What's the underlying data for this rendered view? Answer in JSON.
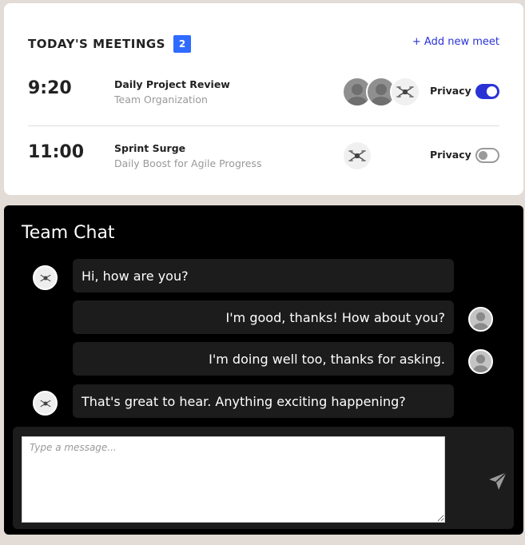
{
  "meetings": {
    "title": "TODAY'S MEETINGS",
    "count": "2",
    "add_label": "+ Add new meet",
    "items": [
      {
        "time": "9:20",
        "title": "Daily Project Review",
        "subtitle": "Team Organization",
        "privacy_label": "Privacy",
        "privacy_on": true,
        "avatars": [
          "person-avatar",
          "person-avatar",
          "drone-avatar"
        ]
      },
      {
        "time": "11:00",
        "title": "Sprint Surge",
        "subtitle": "Daily Boost for Agile Progress",
        "privacy_label": "Privacy",
        "privacy_on": false,
        "avatars": [
          "drone-avatar"
        ]
      }
    ]
  },
  "chat": {
    "title": "Team Chat",
    "messages": [
      {
        "text": "Hi, how are you?",
        "side": "left",
        "avatar": "drone-avatar"
      },
      {
        "text": "I'm good, thanks! How about you?",
        "side": "right",
        "avatar": "person-avatar"
      },
      {
        "text": "I'm doing well too, thanks for asking.",
        "side": "right",
        "avatar": "person-avatar"
      },
      {
        "text": "That's great to hear. Anything exciting happening?",
        "side": "left",
        "avatar": "drone-avatar"
      }
    ],
    "input_placeholder": "Type a message...",
    "send_icon": "paper-plane-icon"
  },
  "colors": {
    "accent": "#2a32d6",
    "badge": "#2f6bff",
    "chat_bg": "#000000",
    "bubble_bg": "#1c1c1c",
    "page_bg": "#e3dcd6"
  }
}
